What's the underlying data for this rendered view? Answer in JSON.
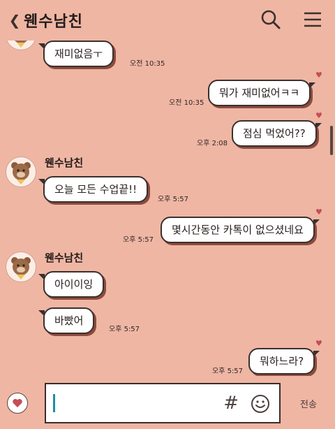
{
  "header": {
    "back_icon": "chevron-left-icon",
    "title": "웬수남친",
    "search_icon": "search-icon",
    "menu_icon": "menu-icon"
  },
  "messages": [
    {
      "side": "left",
      "text": "재미없음ㅜ",
      "time": "오전 10:35"
    },
    {
      "side": "right",
      "text": "뭐가 재미없어ㅋㅋ",
      "time": "오전 10:35"
    },
    {
      "side": "right",
      "text": "점심 먹었어??",
      "time": "오후 2:08"
    },
    {
      "side": "left",
      "sender": "웬수남친",
      "text": "오늘 모든 수업끝!!",
      "time": "오후 5:57"
    },
    {
      "side": "right",
      "text": "몇시간동안 카톡이 없으셨네요",
      "time": "오후 5:57"
    },
    {
      "side": "left",
      "sender": "웬수남친",
      "text": "아이이잉"
    },
    {
      "side": "left",
      "text": "바빴어",
      "time": "오후 5:57"
    },
    {
      "side": "right",
      "text": "뭐하느라?",
      "time": "오후 5:57"
    }
  ],
  "composer": {
    "emoji_icon": "heart-emoticon-icon",
    "hash_label": "#",
    "smile_icon": "smile-icon",
    "send_label": "전송"
  },
  "colors": {
    "background": "#efb6a4",
    "bubble": "#ffffff",
    "bubble_border": "#3a302e",
    "heart": "#c54d56",
    "cursor": "#1f8ea0"
  }
}
